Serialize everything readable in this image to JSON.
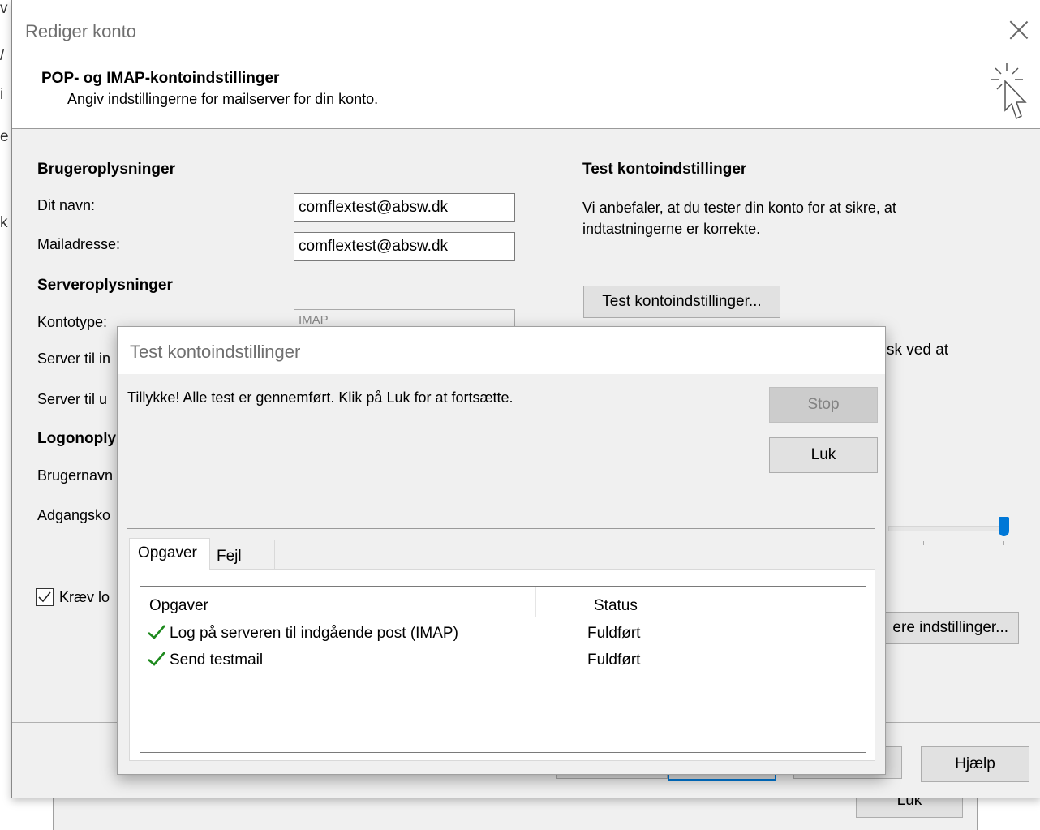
{
  "background": {
    "luk_label": "Luk",
    "edge_glyphs": [
      "v",
      "/",
      "i",
      "e",
      "k"
    ]
  },
  "main_dialog": {
    "title": "Rediger konto",
    "header_bold": "POP- og IMAP-kontoindstillinger",
    "header_sub": "Angiv indstillingerne for mailserver for din konto.",
    "user_info": {
      "heading": "Brugeroplysninger",
      "name_label": "Dit navn:",
      "name_value": "comflextest@absw.dk",
      "email_label": "Mailadresse:",
      "email_value": "comflextest@absw.dk"
    },
    "server_info": {
      "heading": "Serveroplysninger",
      "account_type_label": "Kontotype:",
      "account_type_value": "IMAP",
      "incoming_label_partial": "Server til in",
      "outgoing_label_partial": "Server til u"
    },
    "logon_info": {
      "heading_partial": "Logonoply",
      "username_label_partial": "Brugernavn",
      "password_label_partial": "Adgangsko",
      "require_label_partial": "Kræv lo"
    },
    "test_section": {
      "heading": "Test kontoindstillinger",
      "description": "Vi anbefaler, at du tester din konto for at sikre, at indtastningerne er korrekte.",
      "test_button": "Test kontoindstillinger...",
      "partial_text": "sk ved at",
      "more_settings_partial": "ere indstillinger..."
    },
    "footer": {
      "help_button": "Hjælp"
    }
  },
  "test_dialog": {
    "title": "Test kontoindstillinger",
    "message": "Tillykke! Alle test er gennemført. Klik på Luk for at fortsætte.",
    "stop_button": "Stop",
    "close_button": "Luk",
    "tabs": [
      {
        "label": "Opgaver",
        "active": true
      },
      {
        "label": "Fejl",
        "active": false
      }
    ],
    "columns": [
      "Opgaver",
      "Status"
    ],
    "rows": [
      {
        "task": "Log på serveren til indgående post (IMAP)",
        "status": "Fuldført"
      },
      {
        "task": "Send testmail",
        "status": "Fuldført"
      }
    ]
  },
  "colors": {
    "accent": "#0078d7",
    "success_check": "#1e8a1e",
    "dialog_bg": "#f0f0f0"
  }
}
